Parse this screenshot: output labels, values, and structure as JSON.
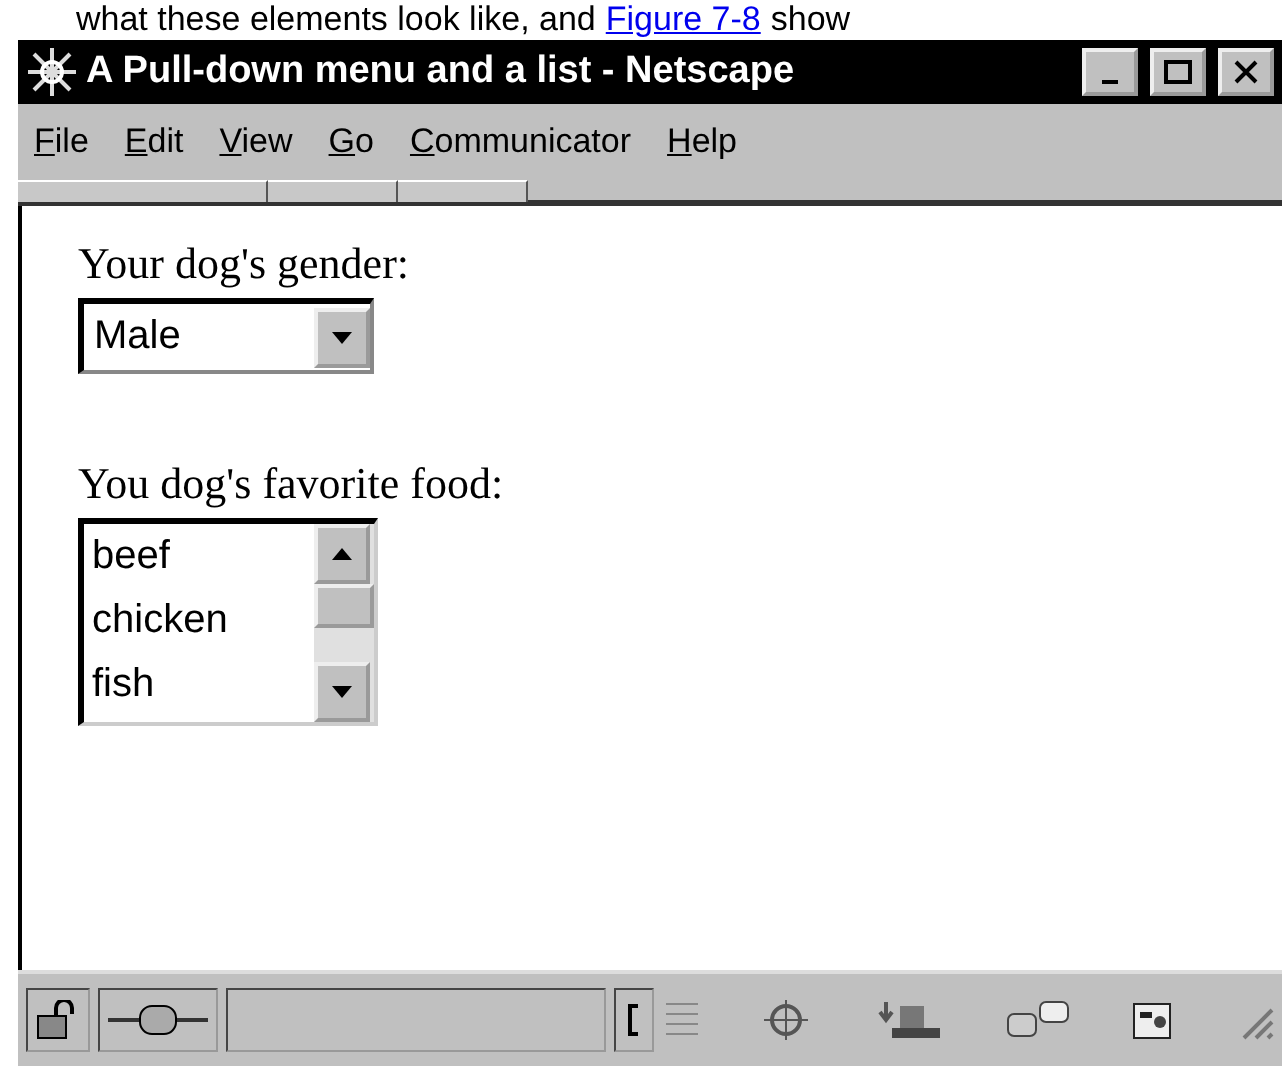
{
  "caption": {
    "before": "what these elements look like, and",
    "link": "Figure 7-8",
    "after": "show"
  },
  "window": {
    "title": "A Pull-down menu and a list - Netscape"
  },
  "menu": [
    {
      "key": "F",
      "rest": "ile"
    },
    {
      "key": "E",
      "rest": "dit"
    },
    {
      "key": "V",
      "rest": "iew"
    },
    {
      "key": "G",
      "rest": "o"
    },
    {
      "key": "C",
      "rest": "ommunicator"
    },
    {
      "key": "H",
      "rest": "elp"
    }
  ],
  "fields": [
    {
      "kind": "select",
      "label": "Your dog's gender:",
      "value": "Male"
    },
    {
      "kind": "list",
      "label": "You dog's favorite food:",
      "options": [
        "beef",
        "chicken",
        "fish"
      ]
    }
  ]
}
